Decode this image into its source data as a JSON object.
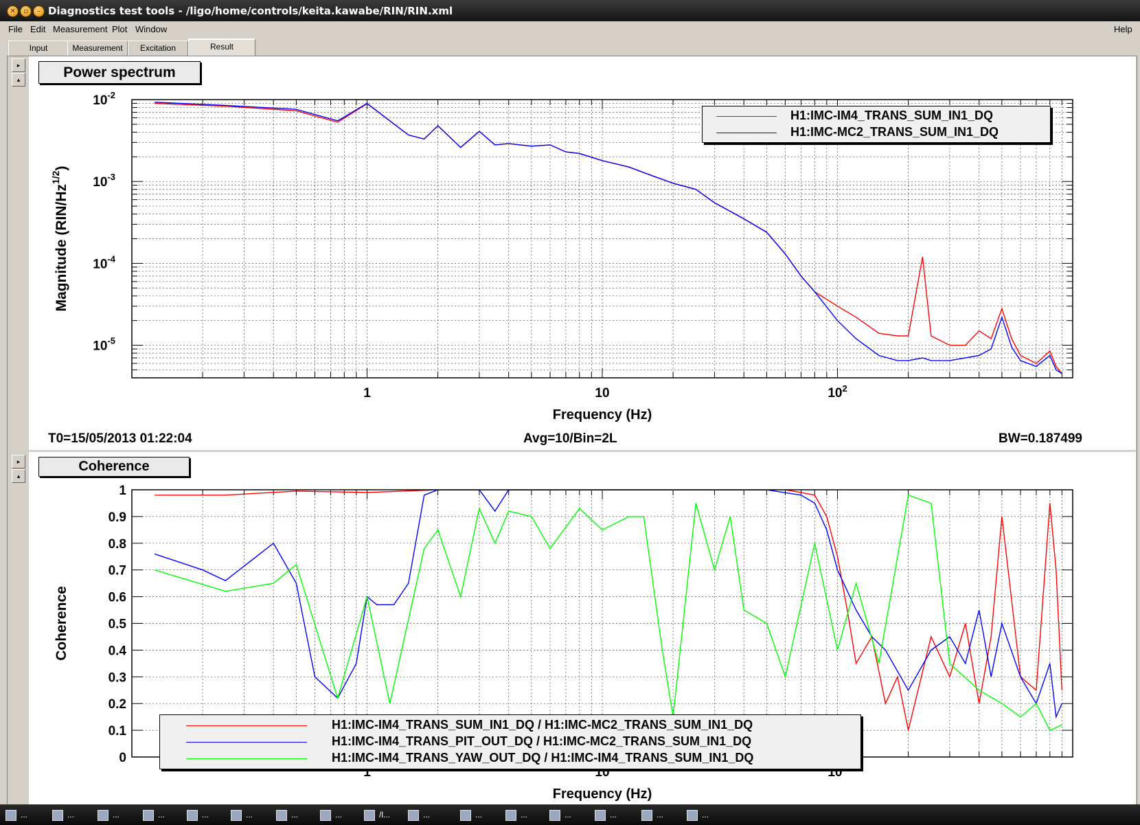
{
  "window": {
    "title": "Diagnostics test tools - /ligo/home/controls/keita.kawabe/RIN/RIN.xml"
  },
  "menu": {
    "items": [
      "File",
      "Edit",
      "Measurement",
      "Plot",
      "Window"
    ],
    "help": "Help"
  },
  "tabs": [
    {
      "label": "Input"
    },
    {
      "label": "Measurement"
    },
    {
      "label": "Excitation"
    },
    {
      "label": "Result",
      "active": true
    }
  ],
  "power_panel": {
    "title": "Power spectrum",
    "t0": "T0=15/05/2013 01:22:04",
    "avg": "Avg=10/Bin=2L",
    "bw": "BW=0.187499"
  },
  "coherence_panel": {
    "title": "Coherence"
  },
  "taskbar": {
    "items": [
      "...",
      "...",
      "...",
      "...",
      "...",
      "...",
      "...",
      "...",
      "/l...",
      "...",
      "...",
      "...",
      "...",
      "...",
      "...",
      "..."
    ]
  },
  "chart_data": [
    {
      "type": "line",
      "title": "Power spectrum",
      "xlabel": "Frequency (Hz)",
      "ylabel": "Magnitude (RIN/Hz^(1/2))",
      "xscale": "log",
      "yscale": "log",
      "xlim": [
        0.1,
        1000
      ],
      "ylim": [
        4e-06,
        0.01
      ],
      "x_ticks": [
        "1",
        "10",
        "10^2"
      ],
      "y_ticks": [
        "10^-2",
        "10^-3",
        "10^-4",
        "10^-5"
      ],
      "grid": true,
      "legend_position": "top-right",
      "series": [
        {
          "name": "H1:IMC-IM4_TRANS_SUM_IN1_DQ",
          "color": "#ff0000",
          "x": [
            0.125,
            0.25,
            0.5,
            0.75,
            1,
            1.25,
            1.5,
            1.75,
            2,
            2.5,
            3,
            3.5,
            4,
            5,
            6,
            7,
            8,
            10,
            13,
            16,
            20,
            25,
            30,
            40,
            50,
            60,
            70,
            80,
            100,
            120,
            150,
            180,
            200,
            230,
            250,
            300,
            350,
            400,
            450,
            500,
            550,
            600,
            700,
            800,
            850,
            900
          ],
          "y": [
            0.009,
            0.0083,
            0.0073,
            0.0053,
            0.0089,
            0.0055,
            0.0037,
            0.0033,
            0.0048,
            0.0026,
            0.0041,
            0.0028,
            0.0029,
            0.0027,
            0.0028,
            0.0023,
            0.0022,
            0.0018,
            0.0015,
            0.0012,
            0.00095,
            0.0008,
            0.00055,
            0.00035,
            0.00024,
            0.00013,
            7e-05,
            4.5e-05,
            3e-05,
            2.2e-05,
            1.4e-05,
            1.3e-05,
            1.3e-05,
            0.00012,
            1.3e-05,
            1e-05,
            1e-05,
            1.5e-05,
            1.2e-05,
            2.8e-05,
            1.2e-05,
            7.5e-06,
            6e-06,
            8.5e-06,
            5.5e-06,
            4.5e-06
          ]
        },
        {
          "name": "H1:IMC-MC2_TRANS_SUM_IN1_DQ",
          "color": "#0000ff",
          "x": [
            0.125,
            0.25,
            0.5,
            0.75,
            1,
            1.25,
            1.5,
            1.75,
            2,
            2.5,
            3,
            3.5,
            4,
            5,
            6,
            7,
            8,
            10,
            13,
            16,
            20,
            25,
            30,
            40,
            50,
            60,
            70,
            80,
            100,
            120,
            150,
            180,
            200,
            230,
            250,
            300,
            350,
            400,
            450,
            500,
            550,
            600,
            700,
            800,
            850,
            900
          ],
          "y": [
            0.0093,
            0.0085,
            0.0076,
            0.0055,
            0.009,
            0.0055,
            0.0037,
            0.0033,
            0.0048,
            0.0026,
            0.0041,
            0.0028,
            0.0029,
            0.0027,
            0.0028,
            0.0023,
            0.0022,
            0.0018,
            0.0015,
            0.0012,
            0.00095,
            0.0008,
            0.00055,
            0.00035,
            0.00024,
            0.00013,
            7e-05,
            4.5e-05,
            2e-05,
            1.2e-05,
            7.5e-06,
            6.5e-06,
            6.5e-06,
            7e-06,
            6.5e-06,
            6.5e-06,
            7e-06,
            7.5e-06,
            9e-06,
            2.2e-05,
            9.5e-06,
            6.5e-06,
            5.5e-06,
            7.5e-06,
            5e-06,
            4.5e-06
          ]
        }
      ]
    },
    {
      "type": "line",
      "title": "Coherence",
      "xlabel": "Frequency (Hz)",
      "ylabel": "Coherence",
      "xscale": "log",
      "yscale": "linear",
      "xlim": [
        0.1,
        1000
      ],
      "ylim": [
        0,
        1
      ],
      "x_ticks": [
        "1",
        "10",
        "10^2"
      ],
      "y_ticks": [
        "0",
        "0.1",
        "0.2",
        "0.3",
        "0.4",
        "0.5",
        "0.6",
        "0.7",
        "0.8",
        "0.9",
        "1"
      ],
      "grid": true,
      "legend_position": "bottom-left",
      "series": [
        {
          "name": "H1:IMC-IM4_TRANS_SUM_IN1_DQ / H1:IMC-MC2_TRANS_SUM_IN1_DQ",
          "color": "#ff0000",
          "x": [
            0.125,
            0.25,
            0.5,
            1,
            2,
            5,
            10,
            20,
            30,
            50,
            60,
            70,
            80,
            90,
            100,
            110,
            120,
            140,
            160,
            180,
            200,
            250,
            300,
            350,
            400,
            450,
            500,
            600,
            700,
            800,
            850,
            900
          ],
          "y": [
            0.98,
            0.98,
            0.995,
            0.99,
            1,
            1,
            1,
            1,
            1,
            1,
            1,
            0.99,
            0.98,
            0.9,
            0.75,
            0.55,
            0.35,
            0.45,
            0.2,
            0.3,
            0.1,
            0.45,
            0.3,
            0.5,
            0.2,
            0.45,
            0.9,
            0.3,
            0.25,
            0.95,
            0.7,
            0.25
          ]
        },
        {
          "name": "H1:IMC-IM4_TRANS_PIT_OUT_DQ / H1:IMC-MC2_TRANS_SUM_IN1_DQ",
          "color": "#0000ff",
          "x": [
            0.125,
            0.2,
            0.25,
            0.4,
            0.5,
            0.6,
            0.75,
            0.9,
            1,
            1.1,
            1.3,
            1.5,
            1.75,
            2,
            3,
            3.5,
            4,
            5,
            10,
            20,
            50,
            70,
            80,
            90,
            100,
            120,
            140,
            160,
            200,
            250,
            300,
            350,
            400,
            450,
            500,
            600,
            700,
            800,
            850,
            900
          ],
          "y": [
            0.76,
            0.7,
            0.66,
            0.8,
            0.65,
            0.3,
            0.22,
            0.35,
            0.6,
            0.57,
            0.57,
            0.65,
            0.98,
            1,
            1,
            0.92,
            1,
            1,
            1,
            1,
            1,
            0.98,
            0.95,
            0.85,
            0.7,
            0.55,
            0.45,
            0.4,
            0.25,
            0.4,
            0.45,
            0.35,
            0.55,
            0.3,
            0.5,
            0.3,
            0.2,
            0.35,
            0.15,
            0.2
          ]
        },
        {
          "name": "H1:IMC-IM4_TRANS_YAW_OUT_DQ / H1:IMC-IM4_TRANS_SUM_IN1_DQ",
          "color": "#00ff00",
          "x": [
            0.125,
            0.25,
            0.4,
            0.5,
            0.75,
            1,
            1.25,
            1.75,
            2,
            2.5,
            3,
            3.5,
            4,
            5,
            6,
            8,
            10,
            13,
            15,
            18,
            20,
            25,
            30,
            35,
            40,
            50,
            60,
            80,
            100,
            120,
            150,
            200,
            250,
            300,
            400,
            500,
            600,
            700,
            800,
            900
          ],
          "y": [
            0.7,
            0.62,
            0.65,
            0.72,
            0.22,
            0.6,
            0.2,
            0.78,
            0.85,
            0.6,
            0.93,
            0.8,
            0.92,
            0.9,
            0.78,
            0.93,
            0.85,
            0.9,
            0.9,
            0.4,
            0.15,
            0.95,
            0.7,
            0.9,
            0.55,
            0.5,
            0.3,
            0.8,
            0.4,
            0.65,
            0.35,
            0.98,
            0.95,
            0.35,
            0.25,
            0.2,
            0.15,
            0.2,
            0.1,
            0.12
          ]
        }
      ]
    }
  ]
}
